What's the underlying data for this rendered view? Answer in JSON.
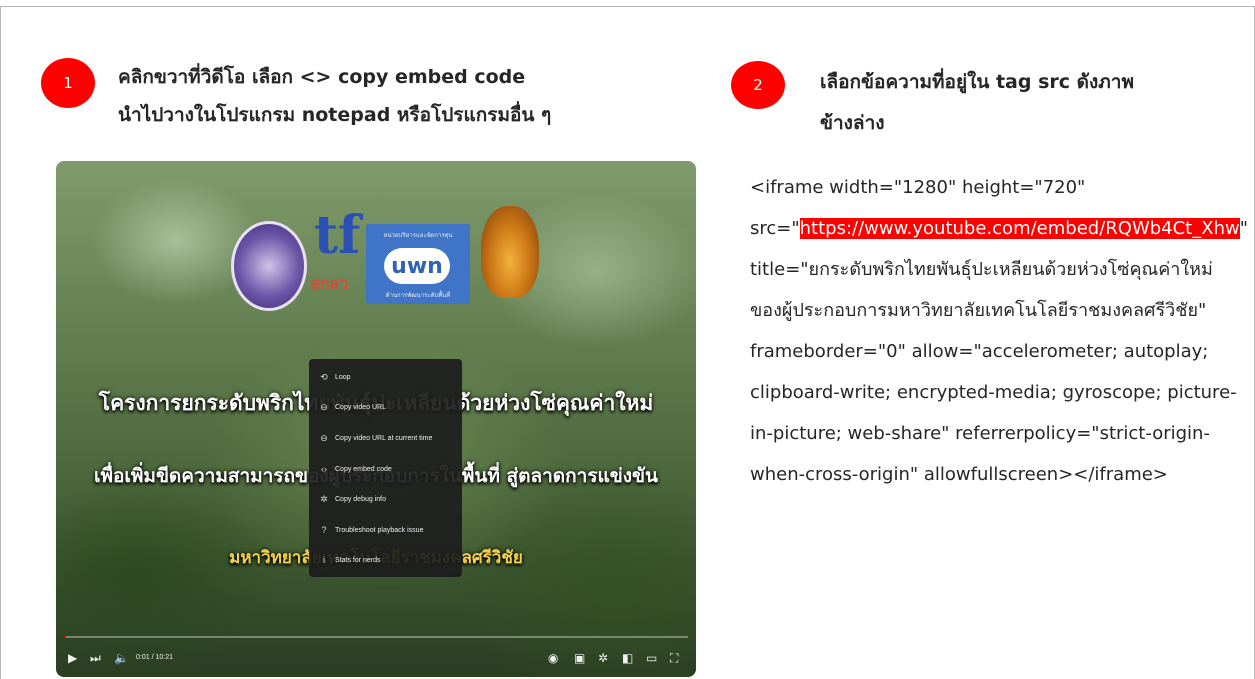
{
  "step1": {
    "badge": "1",
    "line1": "คลิกขวาที่วิดีโอ เลือก <> copy embed code",
    "line2": "นำไปวางในโปรแกรม notepad หรือโปรแกรมอื่น ๆ"
  },
  "step2": {
    "badge": "2",
    "line1": "เลือกข้อความที่อยู่ใน tag src ดังภาพ",
    "line2": "ข้างล่าง"
  },
  "code": {
    "before_src": "<iframe width=\"1280\" height=\"720\" src=\"",
    "src_url": "https://www.youtube.com/embed/RQWb4Ct_Xhw",
    "after_src": "\" title=\"ยกระดับพริกไทยพันธุ์ปะเหลียนด้วยห่วงโซ่คุณค่าใหม่ของผู้ประกอบการมหาวิทยาลัยเทคโนโลยีราชมงคลศรีวิชัย\" frameborder=\"0\" allow=\"accelerometer; autoplay; clipboard-write; encrypted-media; gyroscope; picture-in-picture; web-share\" referrerpolicy=\"strict-origin-when-cross-origin\" allowfullscreen></iframe>",
    "highlight_color": "#ff0000"
  },
  "video": {
    "logos": {
      "tf_letters": "tf",
      "tf_caption": "สกสว",
      "uwn_top": "หน่วยบริหารและจัดการทุน",
      "uwn_label": "uwn",
      "uwn_bottom": "ด้านการพัฒนาระดับพื้นที่"
    },
    "title_line1": "โครงการยกระดับพริกไทยพันธุ์ปะเหลียนด้วยห่วงโซ่คุณค่าใหม่",
    "title_line2": "เพื่อเพิ่มขีดความสามารถของผู้ประกอบการในพื้นที่ สู่ตลาดการแข่งขัน",
    "title_line3": "มหาวิทยาลัยเทคโนโลยีราชมงคลศรีวิชัย",
    "context_menu": [
      {
        "icon": "loop-icon",
        "glyph": "⟲",
        "label": "Loop"
      },
      {
        "icon": "link-icon",
        "glyph": "⊖",
        "label": "Copy video URL"
      },
      {
        "icon": "link-icon",
        "glyph": "⊖",
        "label": "Copy video URL at current time"
      },
      {
        "icon": "code-icon",
        "glyph": "‹›",
        "label": "Copy embed code"
      },
      {
        "icon": "gear-icon",
        "glyph": "✲",
        "label": "Copy debug info"
      },
      {
        "icon": "help-icon",
        "glyph": "?",
        "label": "Troubleshoot playback issue"
      },
      {
        "icon": "info-icon",
        "glyph": "i",
        "label": "Stats for nerds"
      }
    ],
    "time_display": "0:01 / 10:21",
    "progress_fraction": 0.0016,
    "accent_color": "#ff0000"
  }
}
